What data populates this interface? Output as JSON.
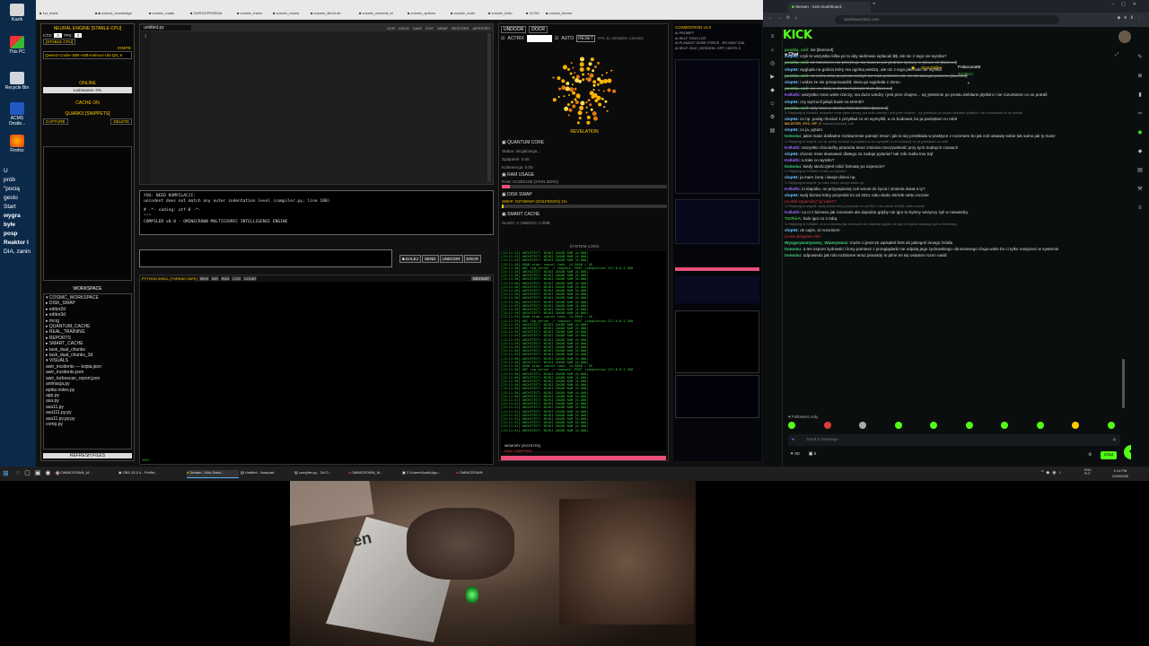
{
  "desktop": {
    "icons": [
      {
        "label": "Kazik"
      },
      {
        "label": "This PC"
      },
      {
        "label": "Recycle Bin"
      },
      {
        "label": "ACMS Onsite..."
      },
      {
        "label": "Firefox"
      }
    ],
    "side_texts": [
      "U",
      "prób",
      "\"pocią",
      "gesto",
      "Start",
      "wygra",
      "byłe",
      "posp",
      "Reaktor I",
      "DIA, zanin"
    ]
  },
  "browser_tabs": [
    "■ 1st_leads",
    "■ ■ cosmic_knowledge",
    "■ cosmic_roads",
    "■ ZAPISZ/PRZEMA",
    "■ cosmic_frame",
    "■ cosmic_rooms",
    "■ cosmic_direct.db",
    "■ cosmic_external_id",
    "■ cosmic_options",
    "■ cosmic_roots",
    "■ cosmic_hello",
    "■ ZUTM",
    "■ cosmic_theme"
  ],
  "neural": {
    "title": "NEURAL ENGINE [STABLE-CPU]",
    "ctx_label": "CTX:",
    "ctx_value": "4",
    "tps_label": "TPS:",
    "tps_value": "4",
    "stable_cpu": "[STABLE CPU]",
    "ignite": "IGNITE",
    "model": "Qwen3-Coder-30B-A3B-Instruct-UD-Q8_K",
    "status": "ONLINE",
    "loading": "Ładowanie: 0%",
    "cache": "CACHE ON",
    "quarks": "QUARKS [SNIPPETS]",
    "capture": "CAPTURE",
    "delete": "DELETE",
    "workspace": "WORKSPACE",
    "tree": [
      "▾ COSMIC_WORKSPACE",
      "  ▸ DISK_SWAP",
      "  ▸ editor2d",
      "  ▸ editor3d",
      "  ▸ mcrg",
      "  ▸ QUANTUM_CACHE",
      "  ▸ REAL_TRAINING",
      "  ▸ REPORTS",
      "  ▸ SMART_CACHE",
      "  ▸ task_dual_chunks",
      "  ▸ task_dual_chunks_3d",
      "  ▾ VISUALS",
      "     awir_incidents — kopia.json",
      "     awir_incidents.json",
      "     awir_turboscan_report.json",
      "     animacja.py",
      "     epika notes.py",
      "     app.py",
      "     asa.py",
      "     asa11.py",
      "     asa111.py.py",
      "     asa11.py.py.py",
      "     comp.py"
    ],
    "refresh": "REFRESH FILES"
  },
  "editor": {
    "tab": "untitled.py",
    "toolbar": [
      "OCR",
      "DOCR",
      "SAVE",
      "EXIT",
      "WRAP",
      "RESTORE",
      "ARTISTRY"
    ],
    "line_num": "1"
  },
  "console": {
    "lines": [
      "YOU: NEED KOMPILACJI:",
      "unindent does not match any outer indentation level (compiler.py, line 180)",
      "",
      "# -*- coding: utf-8 -*-",
      "\"\"\"",
      "COMPILER v8.0 - OMINECROWN MULTICOSMIC INTELLIGENCE ENGINE"
    ]
  },
  "cmd_buttons": [
    "■ DALEJ",
    "SEND",
    "UNDOOR",
    "DOCR"
  ],
  "pyshell": {
    "title": "PYTHON SHELL [THREAD SAFE]",
    "btns": [
      "NEW",
      "INS",
      "RUN",
      "LOG",
      "CLEAR"
    ],
    "restart": "RESTART",
    "prompt": ">>>"
  },
  "quantum": {
    "top_btns": [
      "UNDOOR",
      "DOCR"
    ],
    "actrix": "ACTRIX",
    "auto": "AUTO",
    "reset": "RESET",
    "fps": "FPS: 30 | RENDER: CACHED",
    "revelation": "REVELATION",
    "core_title": "QUANTUM CORE",
    "core_lines": [
      "Status: Inicjalizacja...",
      "Splątanie: 0.00",
      "Koherencja: 0.00"
    ],
    "ram_title": "RAM USAGE",
    "ram_line": "RAM: OCZEKUJE [STAN ZERO]",
    "disk_title": "DISK SWAP",
    "disk_line": "SWAP: OZYWANY (GOLFEGGO) 1%",
    "smart_title": "SMART CACHE",
    "smart_line": "SLADY: 2 | WIEDZA: 0.0MB",
    "logs_title": "SYSTEM LOGS",
    "log_lines": [
      "[13:11:23] ARCHITECT: NISKI ZASOB RAM (0.000)",
      "[13:11:23] ARCHITECT: NISKI ZASOB RAM (0.000)",
      "[13:11:23] ARCHITECT: NISKI ZASOB RAM (0.000)",
      "[13:11:28] QUAN          step: cancel task, 14,5840 + 18",
      "[13:11:28] ARC     log_server -> request: POST /completion 127.0.0.1 200",
      "[13:11:28] ARCHITECT: NISKI ZASOB RAM (0.000)",
      "[13:11:28] ARCHITECT: NISKI ZASOB RAM (0.000)",
      "[13:11:28] ARCHITECT: NISKI ZASOB RAM (0.000)",
      "[13:11:28] ARCHITECT: NISKI ZASOB RAM (0.000)",
      "[13:11:28] ARCHITECT: NISKI ZASOB RAM (0.000)",
      "[13:11:28] ARCHITECT: NISKI ZASOB RAM (0.000)",
      "[13:11:28] ARCHITECT: NISKI ZASOB RAM (0.000)",
      "[13:11:28] ARCHITECT: NISKI ZASOB RAM (0.000)",
      "[13:11:28] ARCHITECT: NISKI ZASOB RAM (0.000)",
      "[13:11:29] ARCHITECT: NISKI ZASOB RAM (0.000)",
      "[13:11:29] ARCHITECT: NISKI ZASOB RAM (0.000)",
      "[13:11:29] ARCHITECT: NISKI ZASOB RAM (0.000)",
      "[13:11:29] QUAN          step: cancel task, 14,5840 + 18",
      "[13:11:29] ARC     log_server -> request: POST /completion 127.0.0.1 200",
      "[13:11:29] ARCHITECT: NISKI ZASOB RAM (0.000)",
      "[13:11:29] ARCHITECT: NISKI ZASOB RAM (0.000)",
      "[13:11:29] ARCHITECT: NISKI ZASOB RAM (0.000)",
      "[13:11:29] ARCHITECT: NISKI ZASOB RAM (0.000)",
      "[13:11:29] ARCHITECT: NISKI ZASOB RAM (0.000)",
      "[13:11:29] ARCHITECT: NISKI ZASOB RAM (0.000)",
      "[13:11:29] ARCHITECT: NISKI ZASOB RAM (0.000)",
      "[13:11:29] ARCHITECT: NISKI ZASOB RAM (0.000)",
      "[13:11:29] ARCHITECT: NISKI ZASOB RAM (0.000)",
      "[13:11:30] ARCHITECT: NISKI ZASOB RAM (0.000)",
      "[13:11:30] ARCHITECT: NISKI ZASOB RAM (0.000)",
      "[13:11:30] QUAN          step: cancel task, 14,5840 + 18",
      "[13:11:30] ARC     log_server -> request: POST /completion 127.0.0.1 200",
      "[13:11:30] ARCHITECT: NISKI ZASOB RAM (0.000)",
      "[13:11:30] ARCHITECT: NISKI ZASOB RAM (0.000)",
      "[13:11:30] ARCHITECT: NISKI ZASOB RAM (0.000)",
      "[13:11:30] ARCHITECT: NISKI ZASOB RAM (0.000)",
      "[13:11:30] ARCHITECT: NISKI ZASOB RAM (0.000)",
      "[13:11:30] ARCHITECT: NISKI ZASOB RAM (0.000)",
      "[13:11:30] ARCHITECT: NISKI ZASOB RAM (0.000)",
      "[13:11:31] ARCHITECT: NISKI ZASOB RAM (0.000)",
      "[13:11:31] ARCHITECT: NISKI ZASOB RAM (0.000)",
      "[13:11:31] ARCHITECT: NISKI ZASOB RAM (0.000)",
      "[13:11:31] ARCHITECT: NISKI ZASOB RAM (0.000)",
      "[13:11:31] ARCHITECT: NISKI ZASOB RAM (0.000)",
      "[13:11:31] ARCHITECT: NISKI ZASOB RAM (0.000)",
      "[13:11:31] ARCHITECT: NISKI ZASOB RAM (0.000)",
      "[13:11:31] ARCHITECT: NISKI ZASOB RAM (0.000)",
      "[13:11:31] ARCHITECT: NISKI ZASOB RAM (0.000)"
    ],
    "memory_title": "MEMORY (ROZSTRZ)",
    "memory_line": "RAM: SWAPPED"
  },
  "rpanel": {
    "title": "COSMOCRON v4.0",
    "lines": [
      "AI PROMPT:",
      "AI SELF TODO LIST",
      "AI PLANOUT SUSIE FORCE - RO WIN? 2/36",
      "AI SELF: IDLE | SESSION: OFF | HINTS: 0"
    ]
  },
  "kick": {
    "tab_title": "Stream - Kick Dashboard",
    "url": "dashboard.kick.com",
    "logo": "KICK",
    "chat_label": "Chat",
    "pinned_user1": "ZiomSkiller",
    "pinned_user2": "Polacooo69",
    "pinned_user3": "ToOhirA",
    "messages": [
      {
        "u": "puszka_coli",
        "c": "#3fc03f",
        "t": "nie [Banned]",
        "cls": ""
      },
      {
        "u": "slop94",
        "c": "#6ec1ff",
        "t": "czyli to wszystko kilka po to aby widzowie wpłacali $$, ale nic z tego nie wynika?",
        "cls": ""
      },
      {
        "u": "puszka_coli",
        "c": "#3fc03f",
        "t": "co rozumiem nie przejmuje się kasą to już grubsze sprawy w glowie ch [Banned]",
        "cls": "del"
      },
      {
        "u": "slop94",
        "c": "#6ec1ff",
        "t": "wygląda na gościa który ma ogólną wiedzę, ale nic z tego jako taki nie wynika",
        "cls": ""
      },
      {
        "u": "puszka_coli",
        "c": "#3fc03f",
        "t": "no ochra toka po prostu kiedyś tez miał poziomie ale nie do takiego poziomu [Banned]",
        "cls": "del"
      },
      {
        "u": "slop94",
        "c": "#6ec1ff",
        "t": "i widze ze sie przeprowadził, stara go wyjebała z domu",
        "cls": ""
      },
      {
        "u": "puszka_coli",
        "c": "#3fc03f",
        "t": "nie on dałej w domku holenderskim [Banned]",
        "cls": "del"
      },
      {
        "u": "Kellathi",
        "c": "#a06bff",
        "t": "wszystko mnie wiele rzeczy, ma dużo wiedzy i jest prze chujem... wy jesteście po prostu debilami plytkimi i nie rozumiecie co on potrafi",
        "cls": ""
      },
      {
        "u": "slop94",
        "c": "#6ec1ff",
        "t": "czy wyrzucił jakąś bude na strimki?",
        "cls": ""
      },
      {
        "u": "puszka_coli",
        "c": "#3fc03f",
        "t": "cały czas w domku holenderskim [Banned]",
        "cls": "del"
      },
      {
        "u": "",
        "c": "#777",
        "t": "↳ Replying to Kellathi: wszystko mnie wiele rzeczy, ma dużo wiedzy i jest prze chujem... wy jesteście po prostu debilami plytkimi i nie rozumiecie co on potrafi",
        "cls": "reply"
      },
      {
        "u": "slop94",
        "c": "#6ec1ff",
        "t": "co np. podaj chociaż 1 przykład co on wymyślił, a co budował, bo ja pamiętam co robił",
        "cls": ""
      },
      {
        "u": "MAJSTER_SYS_VIP_C",
        "c": "#e2a23a",
        "t": "banned puszka_coli",
        "cls": "reply"
      },
      {
        "u": "slop94",
        "c": "#6ec1ff",
        "t": "co ja, pytam",
        "cls": ""
      },
      {
        "u": "tomomu",
        "c": "#3fd27f",
        "t": "jakie masz dokładne rozstarzenie pamięć teraz i jak to się przekłada w praktyce z rozomem bo jak coś ustawię sobie tak samo jak ty masz",
        "cls": ""
      },
      {
        "u": "",
        "c": "#777",
        "t": "↳ Replying to slop94: co np. podaj chociaż 1 przykład co on wymyślił, a co budował, bo ja pamiętam co robił",
        "cls": "reply"
      },
      {
        "u": "Kellathi",
        "c": "#a06bff",
        "t": "wszystko chociażby piramida teraz zmienia rzeczywistość przy tych trudnych czasach",
        "cls": ""
      },
      {
        "u": "slop94",
        "c": "#6ec1ff",
        "t": "chcesz mnie skasować dlatego za zadaje pytania? tak robi mafia tnw trąf",
        "cls": ""
      },
      {
        "u": "Kellathi",
        "c": "#a06bff",
        "t": "a totie co wyszło?",
        "cls": ""
      },
      {
        "u": "tomomu",
        "c": "#3fd27f",
        "t": "kiedy skończyłeś robić formatę po szpencie?",
        "cls": ""
      },
      {
        "u": "",
        "c": "#777",
        "t": "↳ Replying to Kellathi: a totie co wyszło?",
        "cls": "reply"
      },
      {
        "u": "slop94",
        "c": "#6ec1ff",
        "t": "ja mam żonę i dwoje dzieci np.",
        "cls": ""
      },
      {
        "u": "",
        "c": "#777",
        "t": "↳ Replying to slop94: ja mam żonę i dwoje dzieci np.",
        "cls": "reply"
      },
      {
        "u": "Kellathi",
        "c": "#a06bff",
        "t": "to klapsko, on przynajmniej coś wnosi do życia i zmienia świat a ty?",
        "cls": ""
      },
      {
        "u": "slop94",
        "c": "#6ec1ff",
        "t": "swój biznes który przyniósł mi od 2021 roku około 40/43k netto rocznie",
        "cls": ""
      },
      {
        "u": "",
        "c": "#e03c3c",
        "t": "co dziś szpencilu? ty wiesz?",
        "cls": ""
      },
      {
        "u": "",
        "c": "#777",
        "t": "↳ Replying to slop94: swój biznes który przyniósł mi od 2021 roku około 40/43k netto rocznie",
        "cls": "reply"
      },
      {
        "u": "Kellathi",
        "c": "#a06bff",
        "t": "co ci z biznesu jak rozonaris ale dojedzie gdyby nie igor to byśmy wszyscy żyli w niewiedzy",
        "cls": ""
      },
      {
        "u": "ToOhirA",
        "c": "#3fc03f",
        "t": "halo igor co z tobą",
        "cls": ""
      },
      {
        "u": "",
        "c": "#777",
        "t": "↳ Replying to Kellathi: co ci z biznesu jak rozonaris ale dojedzie gdyby nie igor to byśmy wszyscy żyli w niewiedzy",
        "cls": "reply"
      },
      {
        "u": "slop94",
        "c": "#6ec1ff",
        "t": "ok cajże, i2 rozumiem",
        "cls": ""
      },
      {
        "u": "",
        "c": "#e03c3c",
        "t": "co ten program robi",
        "cls": ""
      },
      {
        "u": "Wyzgarywanywany_Wiamywanz",
        "c": "#3fd27f",
        "t": "może ci jeszcze wpisałeś limit do jakiegoś innego źródła",
        "cls": ""
      },
      {
        "u": "tomomu",
        "c": "#3fd27f",
        "t": "a ten szpont żydowski i linny pomiesz z przeglądarki nie odpalą jego żydowskiego obrzezanego chuja wiele bo ci tylko roszponci w systemie",
        "cls": ""
      },
      {
        "u": "tomomu",
        "c": "#3fd27f",
        "t": "odpowiedz jak robi rozbiorne teraz piramidy to pline mi się ostatnio rozon nasili",
        "cls": ""
      }
    ],
    "followers_only": "♥ Followers only",
    "send_placeholder": "Send a message",
    "chat_button": "Chat",
    "bottom_counts": [
      "00",
      "0"
    ]
  },
  "taskbar": {
    "items": [
      "OMNICROWN_M...",
      "OBS 32.0.4 - Profile...",
      "Stream - Kick Dash...",
      "Untitled - Notepad",
      "compiler.py - Dri D...",
      "OMNICROWN_M...",
      "C:\\Users\\Kazik\\App...",
      "OMNICROWN"
    ],
    "lang": "ENG\nPLP",
    "time": "2:11 PM",
    "date": "2/26/2026"
  },
  "colors": {
    "kick_green": "#53fc18",
    "accent_yellow": "#ffcc00",
    "terminal_green": "#3ad33a",
    "desktop_blue": "#0b2a4a"
  }
}
